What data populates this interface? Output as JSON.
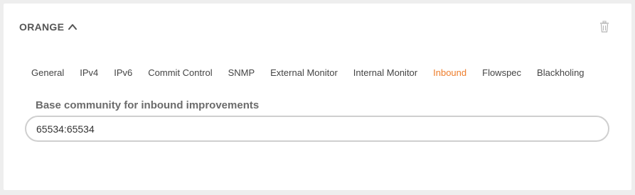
{
  "panel": {
    "title": "ORANGE",
    "toggle_icon": "chevron-up-icon",
    "delete_icon": "trash-icon"
  },
  "tabs": [
    {
      "label": "General",
      "active": false
    },
    {
      "label": "IPv4",
      "active": false
    },
    {
      "label": "IPv6",
      "active": false
    },
    {
      "label": "Commit Control",
      "active": false
    },
    {
      "label": "SNMP",
      "active": false
    },
    {
      "label": "External Monitor",
      "active": false
    },
    {
      "label": "Internal Monitor",
      "active": false
    },
    {
      "label": "Inbound",
      "active": true
    },
    {
      "label": "Flowspec",
      "active": false
    },
    {
      "label": "Blackholing",
      "active": false
    }
  ],
  "inbound": {
    "base_community_label": "Base community for inbound improvements",
    "base_community_value": "65534:65534"
  },
  "colors": {
    "active_tab": "#ee7d2b",
    "title": "#555555",
    "page_background": "#eeeeee"
  }
}
